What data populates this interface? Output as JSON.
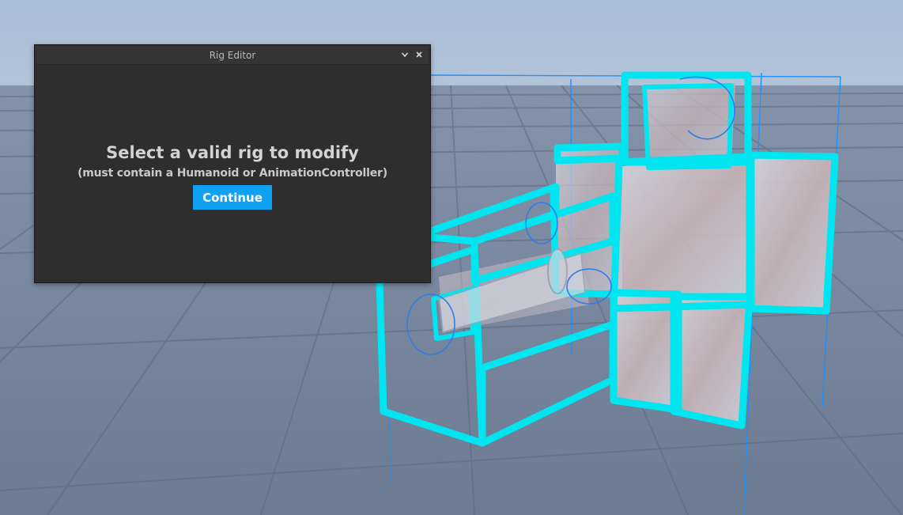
{
  "dialog": {
    "title": "Rig Editor",
    "collapse_icon": "chevron-down-icon",
    "close_icon": "close-icon",
    "message": "Select a valid rig to modify",
    "submessage": "(must contain a Humanoid or AnimationController)",
    "continue_label": "Continue"
  },
  "colors": {
    "accent": "#10a1f2",
    "selection_outline": "#00e5f0",
    "bounding_box": "#1e90ff",
    "panel_bg": "#2e2e2e"
  }
}
